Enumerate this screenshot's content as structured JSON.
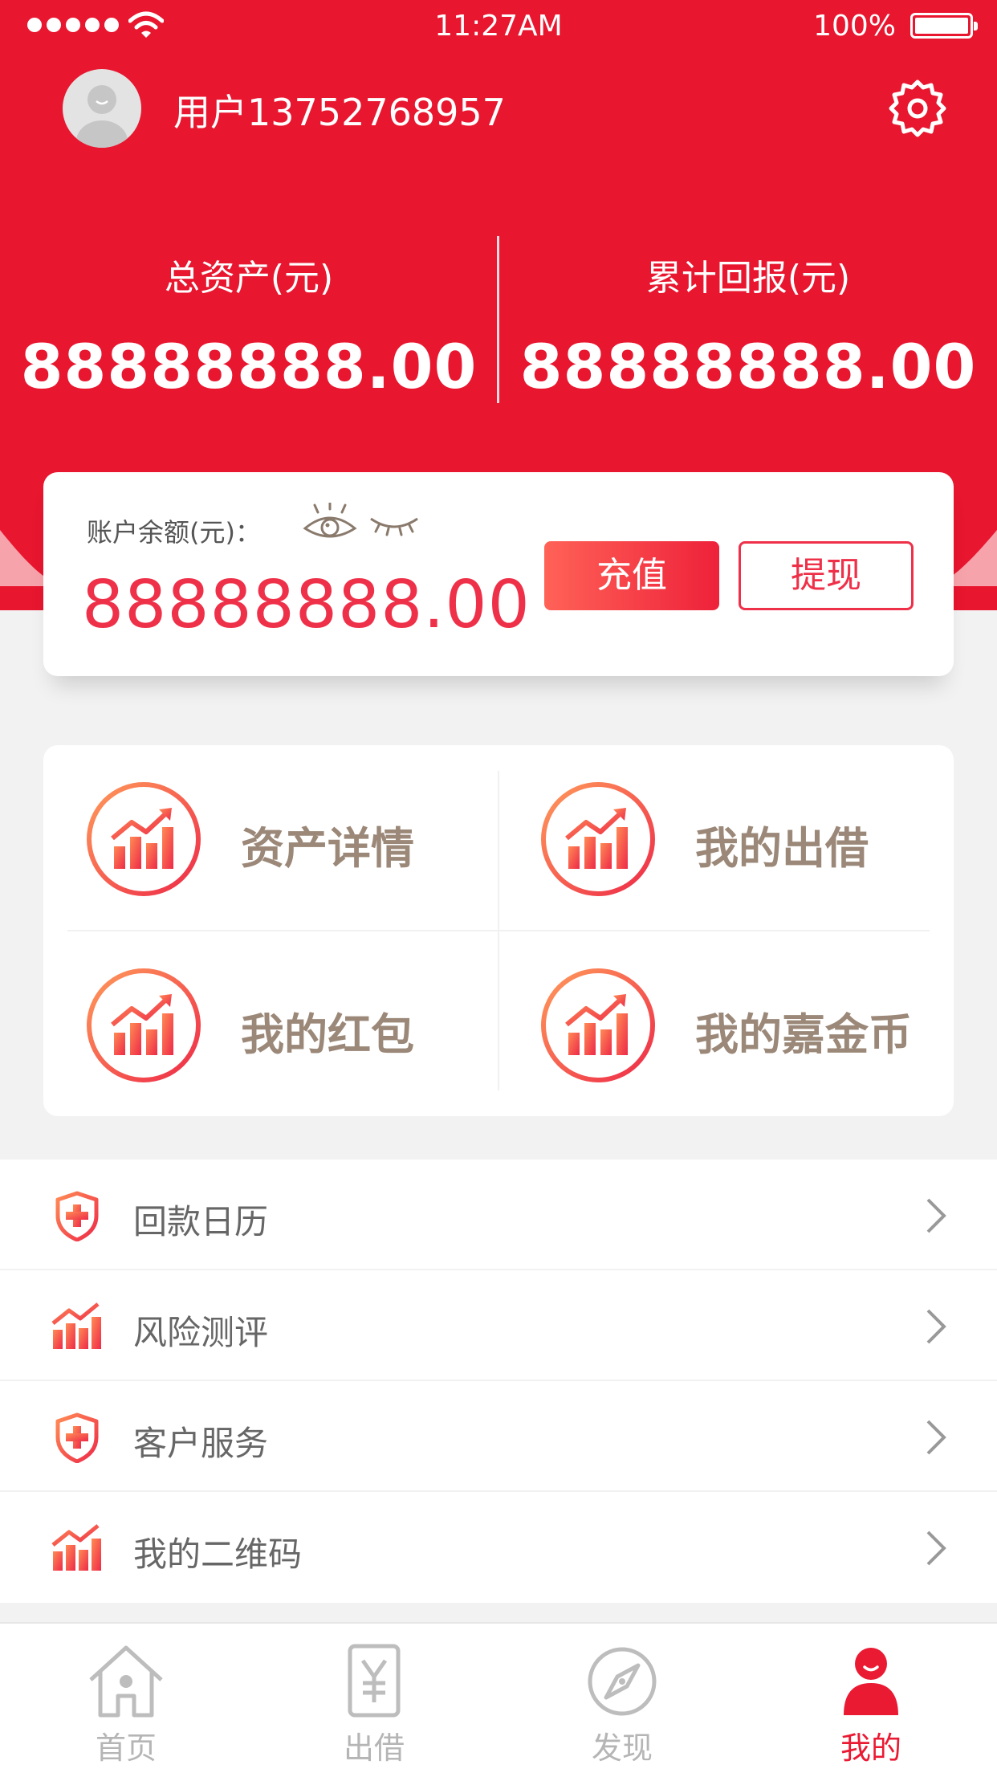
{
  "status_bar": {
    "time": "11:27AM",
    "battery": "100%"
  },
  "profile": {
    "username": "用户13752768957"
  },
  "totals": {
    "total_assets_label": "总资产(元)",
    "total_assets_value": "88888888.00",
    "cumulative_return_label": "累计回报(元)",
    "cumulative_return_value": "88888888.00"
  },
  "balance": {
    "label": "账户余额(元)：",
    "value": "88888888.00",
    "recharge_label": "充值",
    "withdraw_label": "提现"
  },
  "grid": [
    {
      "label": "资产详情",
      "icon": "chart-up-icon"
    },
    {
      "label": "我的出借",
      "icon": "chart-up-icon"
    },
    {
      "label": "我的红包",
      "icon": "chart-up-icon"
    },
    {
      "label": "我的嘉金币",
      "icon": "chart-up-icon"
    }
  ],
  "menu": [
    {
      "label": "回款日历",
      "icon": "shield-plus-icon"
    },
    {
      "label": "风险测评",
      "icon": "chart-up-icon"
    },
    {
      "label": "客户服务",
      "icon": "shield-plus-icon"
    },
    {
      "label": "我的二维码",
      "icon": "chart-up-icon"
    }
  ],
  "tabs": [
    {
      "label": "首页",
      "icon": "home-icon",
      "active": false
    },
    {
      "label": "出借",
      "icon": "yen-doc-icon",
      "active": false
    },
    {
      "label": "发现",
      "icon": "compass-icon",
      "active": false
    },
    {
      "label": "我的",
      "icon": "user-icon",
      "active": true
    }
  ],
  "colors": {
    "brand_red": "#e8162f",
    "accent_red": "#ee3049",
    "gradient_orange": "#ff9a5a",
    "grid_label": "#9b8878",
    "inactive_tab": "#b5b5b5"
  }
}
